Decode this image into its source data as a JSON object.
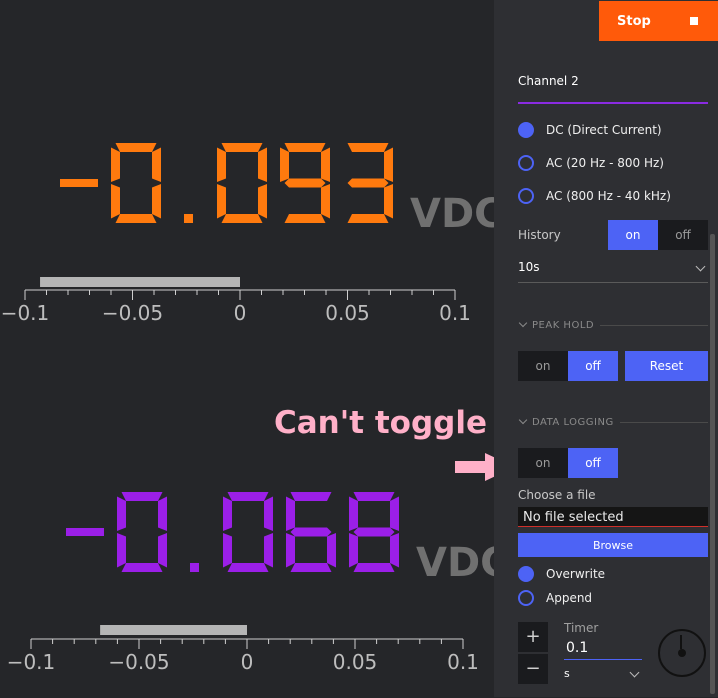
{
  "header": {
    "stop_label": "Stop"
  },
  "readout1": {
    "value": "-0.093",
    "unit": "VDC",
    "color": "#ff7a0e",
    "bar_value": -0.093
  },
  "readout2": {
    "value": "-0.068",
    "unit": "VDC",
    "color": "#9b1fe8",
    "bar_value": -0.068
  },
  "scale": {
    "min": -0.1,
    "max": 0.1,
    "ticks": [
      "−0.1",
      "−0.05",
      "0",
      "0.05",
      "0.1"
    ]
  },
  "panel": {
    "channel": "Channel 2",
    "modes": [
      {
        "label": "DC (Direct Current)",
        "selected": true
      },
      {
        "label": "AC (20 Hz - 800 Hz)",
        "selected": false
      },
      {
        "label": "AC (800 Hz - 40 kHz)",
        "selected": false
      }
    ],
    "history": {
      "label": "History",
      "on": "on",
      "off": "off",
      "value": "10s"
    },
    "peak_hold": {
      "title": "PEAK HOLD",
      "on": "on",
      "off": "off",
      "reset": "Reset"
    },
    "data_logging": {
      "title": "DATA LOGGING",
      "on": "on",
      "off": "off",
      "choose_file_label": "Choose a file",
      "file_value": "No file selected",
      "browse": "Browse",
      "overwrite": "Overwrite",
      "append": "Append"
    },
    "timer": {
      "label": "Timer",
      "value": "0.1",
      "unit": "s",
      "plus": "+",
      "minus": "−"
    }
  },
  "annotation": {
    "text": "Can't toggle",
    "arrow_color": "#ffb0c8"
  },
  "colors": {
    "accent": "#4d63f5",
    "stop": "#ff5a0a",
    "channel_line": "#8a2be2"
  }
}
